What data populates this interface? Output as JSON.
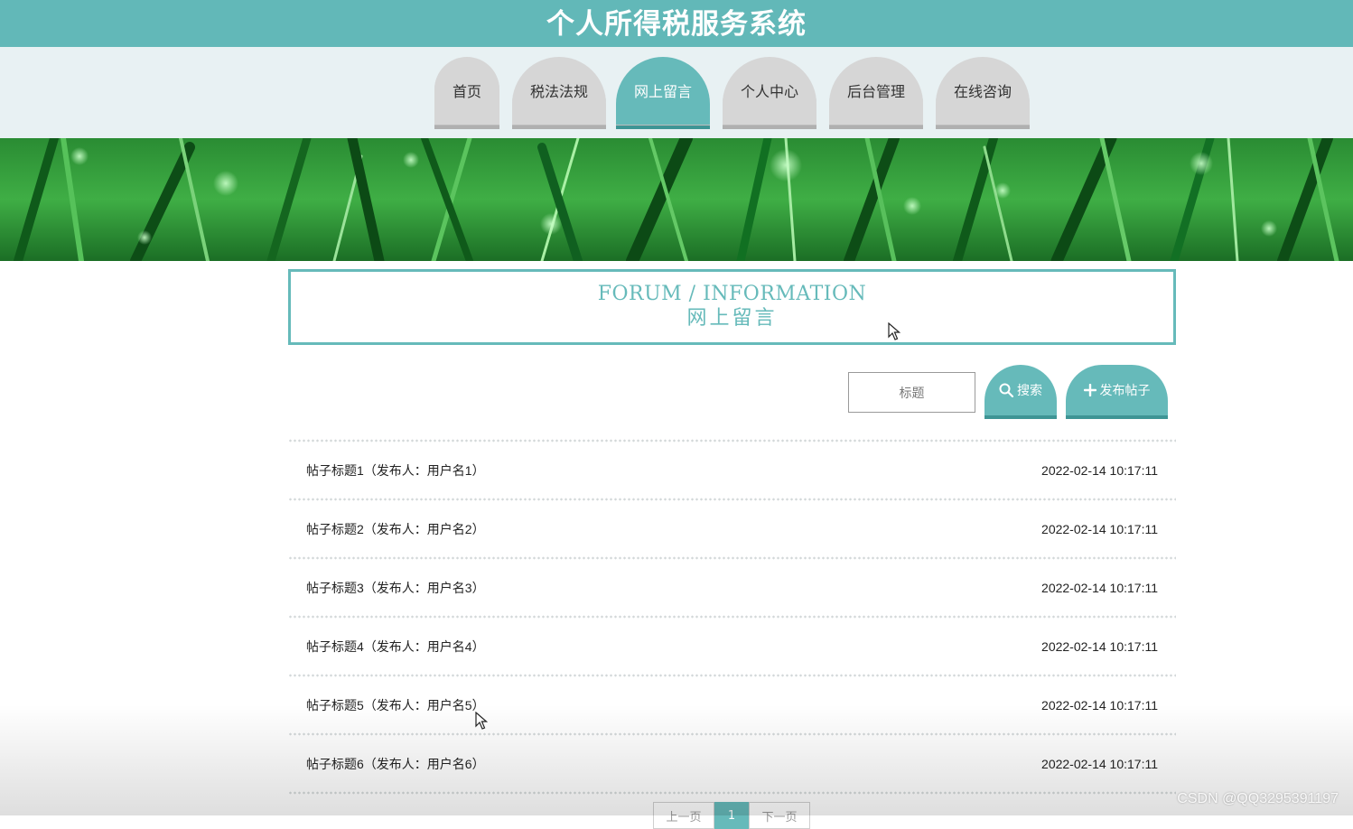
{
  "header": {
    "title": "个人所得税服务系统"
  },
  "nav": {
    "items": [
      {
        "label": "首页"
      },
      {
        "label": "税法法规"
      },
      {
        "label": "网上留言"
      },
      {
        "label": "个人中心"
      },
      {
        "label": "后台管理"
      },
      {
        "label": "在线咨询"
      }
    ],
    "active_index": 2
  },
  "section": {
    "title_en": "FORUM / INFORMATION",
    "title_cn": "网上留言"
  },
  "search": {
    "placeholder": "标题",
    "search_label": "搜索",
    "publish_label": "发布帖子"
  },
  "posts": [
    {
      "title": "帖子标题1（发布人：用户名1）",
      "time": "2022-02-14 10:17:11"
    },
    {
      "title": "帖子标题2（发布人：用户名2）",
      "time": "2022-02-14 10:17:11"
    },
    {
      "title": "帖子标题3（发布人：用户名3）",
      "time": "2022-02-14 10:17:11"
    },
    {
      "title": "帖子标题4（发布人：用户名4）",
      "time": "2022-02-14 10:17:11"
    },
    {
      "title": "帖子标题5（发布人：用户名5）",
      "time": "2022-02-14 10:17:11"
    },
    {
      "title": "帖子标题6（发布人：用户名6）",
      "time": "2022-02-14 10:17:11"
    }
  ],
  "pagination": {
    "prev_label": "上一页",
    "current_page": "1",
    "next_label": "下一页"
  },
  "watermark": "CSDN @QQ3295391197",
  "colors": {
    "accent": "#66baba",
    "header": "#62b8b8",
    "nav_bg": "#e8f1f3",
    "tab_inactive": "#d6d6d6"
  }
}
